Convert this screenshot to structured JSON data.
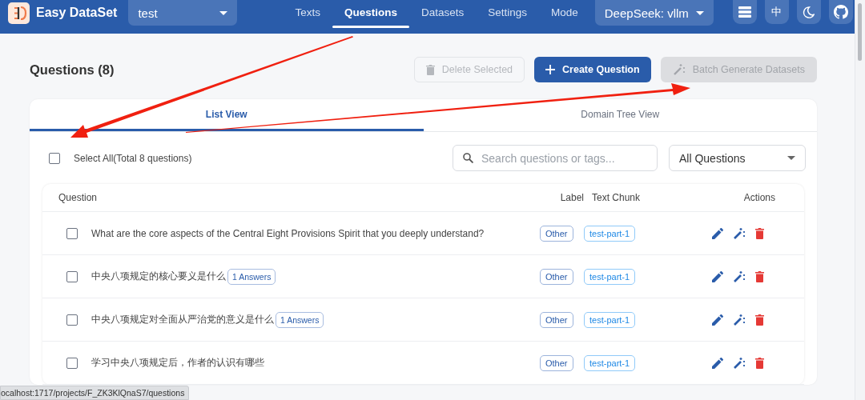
{
  "header": {
    "app_name": "Easy DataSet",
    "project_select": "test",
    "nav": [
      {
        "label": "Texts",
        "selected": false
      },
      {
        "label": "Questions",
        "selected": true
      },
      {
        "label": "Datasets",
        "selected": false
      },
      {
        "label": "Settings",
        "selected": false
      },
      {
        "label": "Mode",
        "selected": false
      }
    ],
    "model_select": "DeepSeek: vllm",
    "language_button": "中"
  },
  "page": {
    "title": "Questions (8)",
    "buttons": [
      {
        "label": "Delete Selected",
        "kind": "delete",
        "disabled": true
      },
      {
        "label": "Create Question",
        "kind": "create",
        "disabled": false
      },
      {
        "label": "Batch Generate Datasets",
        "kind": "generate",
        "disabled": true
      }
    ]
  },
  "view_tabs": [
    {
      "label": "List View",
      "selected": true
    },
    {
      "label": "Domain Tree View",
      "selected": false
    }
  ],
  "toolbar": {
    "select_all": {
      "label": "Select All(Total 8 questions)",
      "checked": false
    },
    "search": {
      "placeholder": "Search questions or tags..."
    },
    "filter": "All Questions"
  },
  "table": {
    "columns": [
      "Question",
      "Label",
      "Text Chunk",
      "Actions"
    ],
    "rows": [
      {
        "checked": false,
        "question": "What are the core aspects of the Central Eight Provisions Spirit that you deeply understand?",
        "label": "Other",
        "chunk": "test-part-1"
      },
      {
        "checked": false,
        "question": "中央八项规定的核心要义是什么",
        "answers": "1 Answers",
        "label": "Other",
        "chunk": "test-part-1"
      },
      {
        "checked": false,
        "question": "中央八项规定对全面从严治党的意义是什么",
        "answers": "1 Answers",
        "label": "Other",
        "chunk": "test-part-1"
      },
      {
        "checked": false,
        "question": "学习中央八项规定后，作者的认识有哪些",
        "label": "Other",
        "chunk": "test-part-1"
      }
    ]
  },
  "status_bar": "ocalhost:1717/projects/F_ZK3KlQnaS7/questions"
}
